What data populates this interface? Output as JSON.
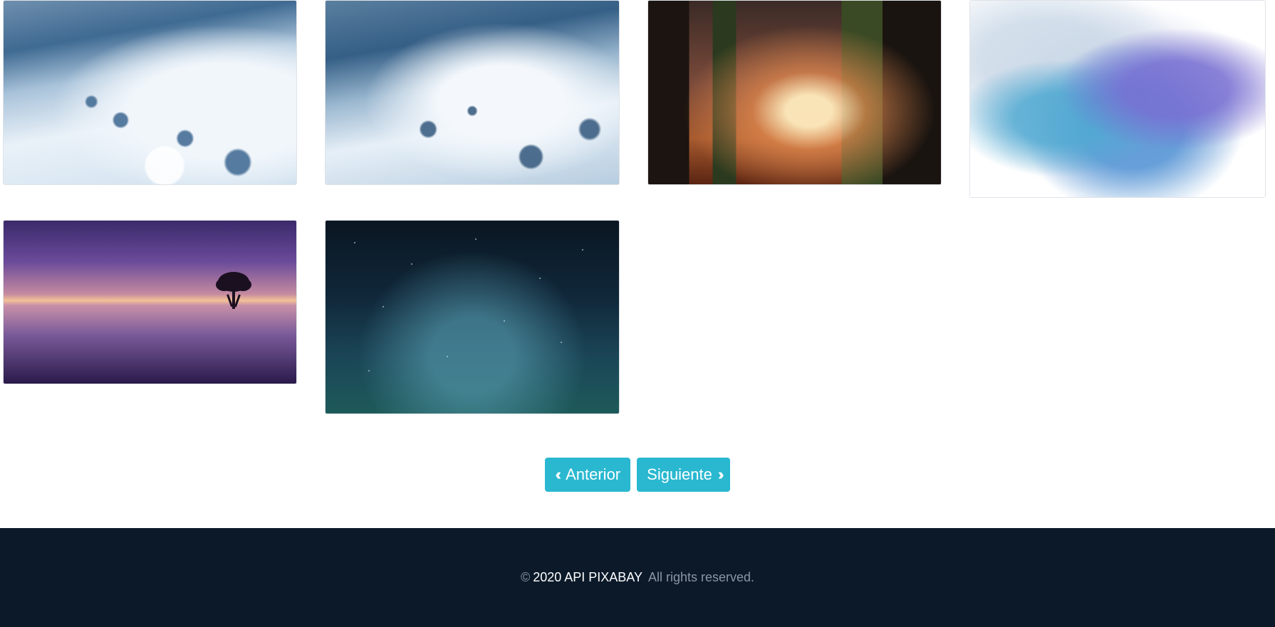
{
  "gallery": {
    "images": [
      {
        "subject": "water splash"
      },
      {
        "subject": "water splash"
      },
      {
        "subject": "forest path with glowing light"
      },
      {
        "subject": "blue watercolor wash"
      },
      {
        "subject": "tree in lake at sunset"
      },
      {
        "subject": "starry night sky"
      }
    ]
  },
  "pagination": {
    "prev_label": "Anterior",
    "next_label": "Siguiente",
    "prev_icon": "double-chevron-left-icon",
    "next_icon": "double-chevron-right-icon",
    "button_color": "#2ab8d0"
  },
  "footer": {
    "copyright_symbol": "©",
    "brand": "2020 API PIXABAY",
    "rights": "All rights reserved.",
    "background_color": "#0b1929"
  }
}
